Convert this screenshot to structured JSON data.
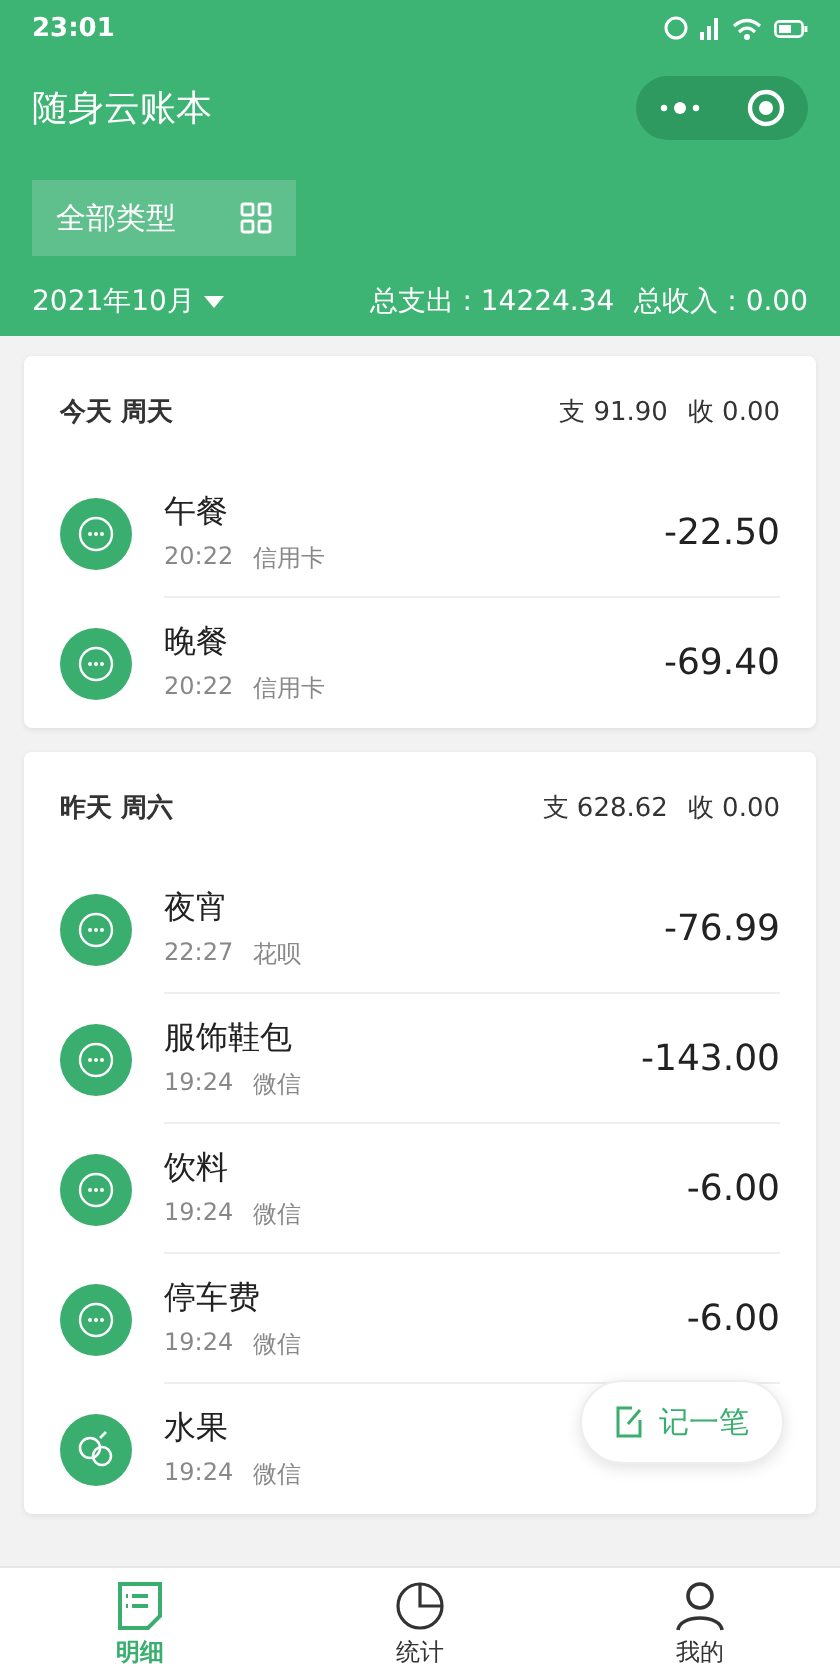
{
  "status_bar": {
    "time": "23:01"
  },
  "header": {
    "title": "随身云账本",
    "filter": "全部类型",
    "month": "2021年10月",
    "expense": "总支出 : 14224.34",
    "income": "总收入 : 0.00"
  },
  "days": [
    {
      "title": "今天 周天",
      "expense": "支 91.90",
      "income": "收 0.00",
      "records": [
        {
          "kind": "more",
          "name": "午餐",
          "time": "20:22",
          "account": "信用卡",
          "amount": "-22.50"
        },
        {
          "kind": "more",
          "name": "晚餐",
          "time": "20:22",
          "account": "信用卡",
          "amount": "-69.40"
        }
      ]
    },
    {
      "title": "昨天 周六",
      "expense": "支 628.62",
      "income": "收 0.00",
      "records": [
        {
          "kind": "more",
          "name": "夜宵",
          "time": "22:27",
          "account": "花呗",
          "amount": "-76.99"
        },
        {
          "kind": "more",
          "name": "服饰鞋包",
          "time": "19:24",
          "account": "微信",
          "amount": "-143.00"
        },
        {
          "kind": "more",
          "name": "饮料",
          "time": "19:24",
          "account": "微信",
          "amount": "-6.00"
        },
        {
          "kind": "more",
          "name": "停车费",
          "time": "19:24",
          "account": "微信",
          "amount": "-6.00"
        },
        {
          "kind": "fruit",
          "name": "水果",
          "time": "19:24",
          "account": "微信"
        }
      ]
    }
  ],
  "fab": {
    "label": "记一笔"
  },
  "tabs": [
    {
      "kind": "detail",
      "label": "明细",
      "selected": true
    },
    {
      "kind": "stats",
      "label": "统计",
      "selected": false
    },
    {
      "kind": "me",
      "label": "我的",
      "selected": false
    }
  ]
}
